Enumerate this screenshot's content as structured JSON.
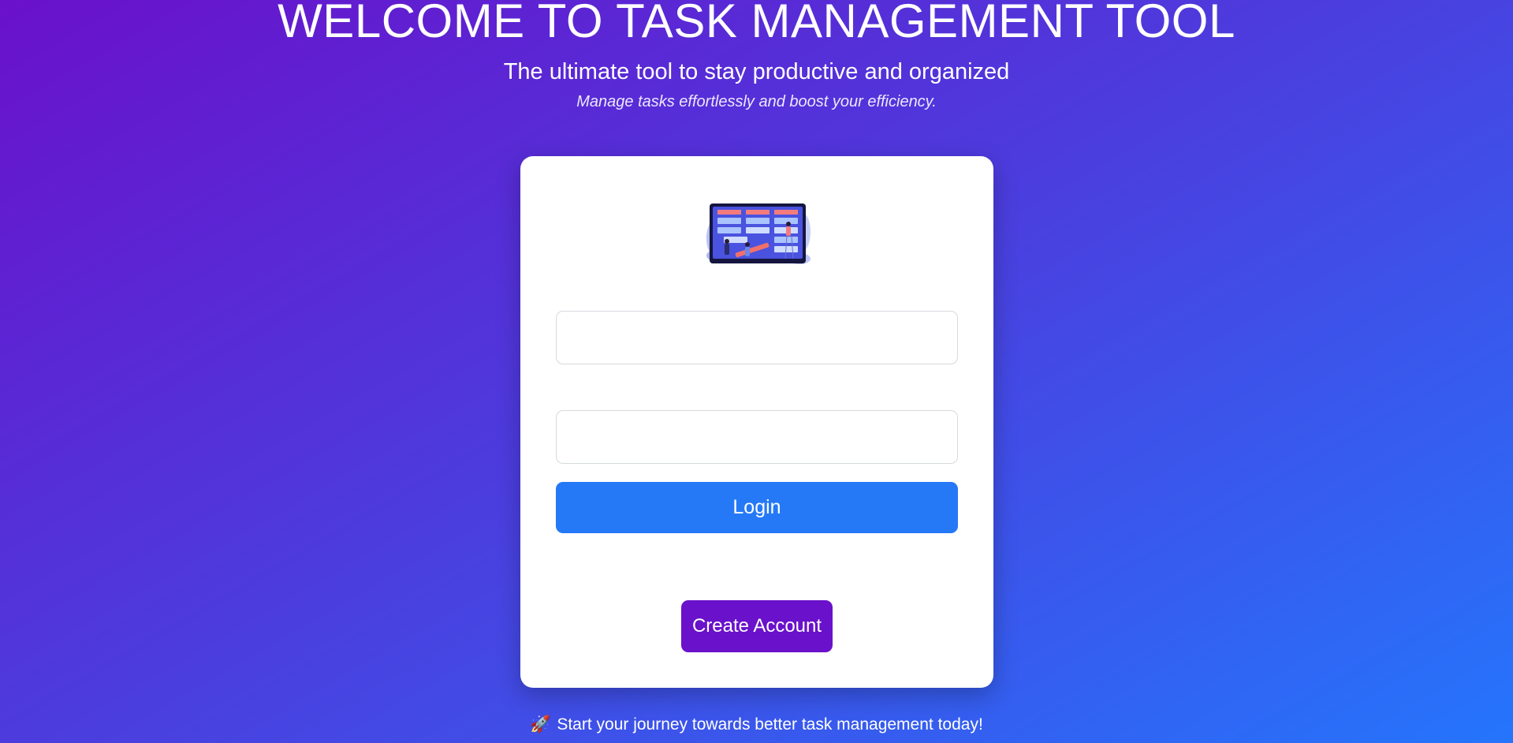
{
  "header": {
    "title": "WELCOME TO TASK MANAGEMENT TOOL",
    "subtitle": "The ultimate tool to stay productive and organized",
    "tagline": "Manage tasks effortlessly and boost your efficiency."
  },
  "card": {
    "illustration": "task-board-illustration",
    "fields": [
      {
        "name": "username",
        "value": "",
        "placeholder": ""
      },
      {
        "name": "password",
        "value": "",
        "placeholder": ""
      }
    ],
    "login_label": "Login",
    "create_account_label": "Create Account"
  },
  "footer": {
    "icon": "rocket-icon",
    "icon_glyph": "🚀",
    "text": "Start your journey towards better task management today!"
  },
  "colors": {
    "background_start": "#6a11cb",
    "background_end": "#2575fc",
    "login_button": "#2579f7",
    "create_account_button": "#6a11cb",
    "card": "#ffffff"
  }
}
